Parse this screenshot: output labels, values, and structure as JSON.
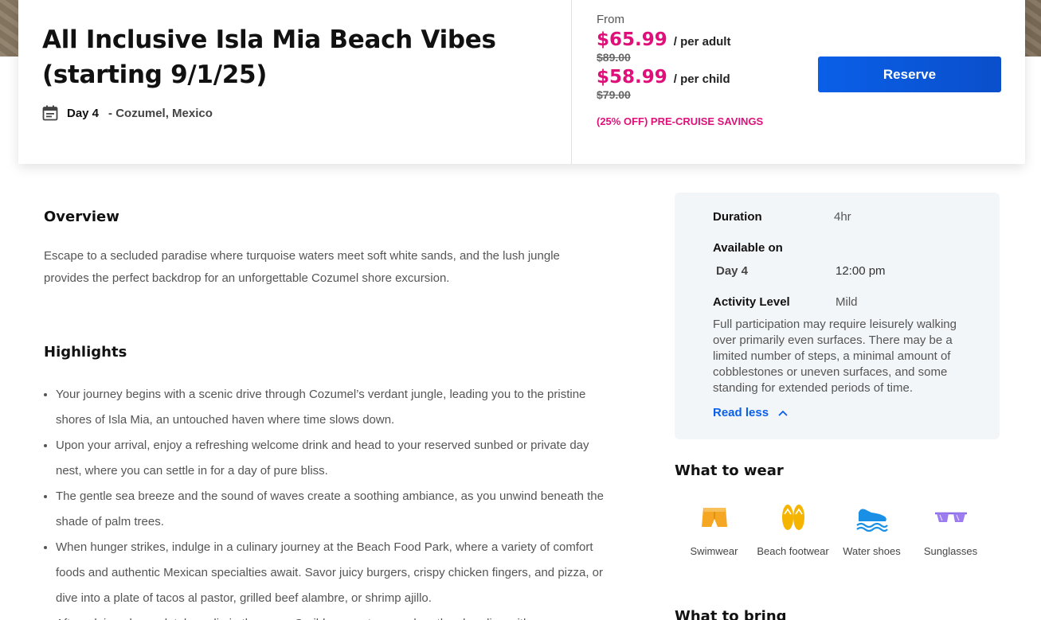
{
  "header": {
    "title": "All Inclusive Isla Mia Beach Vibes (starting 9/1/25)",
    "day": "Day 4",
    "location": "- Cozumel, Mexico"
  },
  "pricing": {
    "from_label": "From",
    "adult_price": "$65.99",
    "adult_unit": "/ per adult",
    "adult_original": "$89.00",
    "child_price": "$58.99",
    "child_unit": "/ per child",
    "child_original": "$79.00",
    "savings": "(25% OFF) PRE-CRUISE SAVINGS",
    "reserve_label": "Reserve",
    "accent_color": "#e0107a",
    "button_color": "#0a5fe8"
  },
  "overview": {
    "heading": "Overview",
    "text": "Escape to a secluded paradise where turquoise waters meet soft white sands, and the lush jungle provides the perfect backdrop for an unforgettable Cozumel shore excursion."
  },
  "highlights": {
    "heading": "Highlights",
    "items": [
      "Your journey begins with a scenic drive through Cozumel’s verdant jungle, leading you to the pristine shores of Isla Mia, an untouched haven where time slows down.",
      "Upon your arrival, enjoy a refreshing welcome drink and head to your reserved sunbed or private day nest, where you can settle in for a day of pure bliss.",
      "The gentle sea breeze and the sound of waves create a soothing ambiance, as you unwind beneath the shade of palm trees.",
      "When hunger strikes, indulge in a culinary journey at the Beach Food Park, where a variety of comfort foods and authentic Mexican specialties await. Savor juicy burgers, crispy chicken fingers, and pizza, or dive into a plate of tacos al pastor, grilled beef alambre, or shrimp ajillo.",
      "After a leisurely meal, take a dip in the warm Caribbean waters, explore the shoreline with a"
    ]
  },
  "info": {
    "duration_label": "Duration",
    "duration_value": "4hr",
    "available_label": "Available on",
    "available_day": "Day 4",
    "available_time": "12:00 pm",
    "activity_label": "Activity Level",
    "activity_value": "Mild",
    "activity_desc": "Full participation may require leisurely walking over primarily even surfaces. There may be a limited number of steps, a minimal amount of cobblestones or uneven surfaces, and some standing for extended periods of time.",
    "read_less": "Read less"
  },
  "wear": {
    "heading": "What to wear",
    "items": [
      {
        "label": "Swimwear",
        "icon": "swimwear-icon"
      },
      {
        "label": "Beach footwear",
        "icon": "flip-flops-icon"
      },
      {
        "label": "Water shoes",
        "icon": "water-shoes-icon"
      },
      {
        "label": "Sunglasses",
        "icon": "sunglasses-icon"
      }
    ]
  },
  "bring": {
    "heading": "What to bring"
  }
}
